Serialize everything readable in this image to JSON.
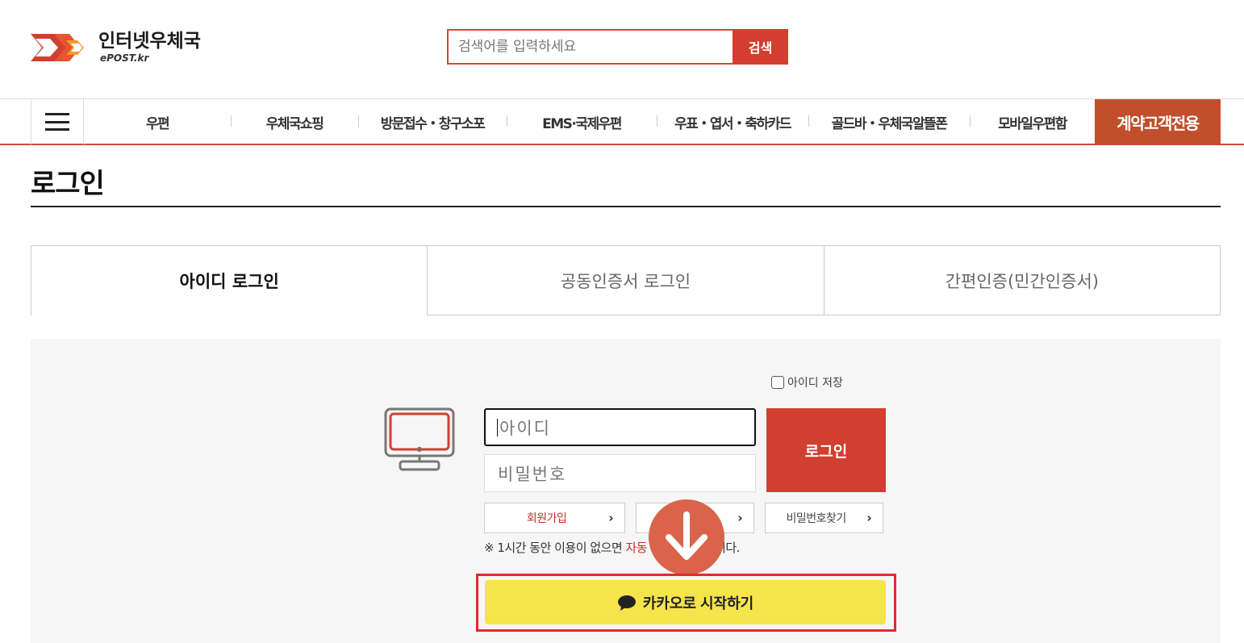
{
  "header": {
    "logo_title": "인터넷우체국",
    "logo_sub": "ePOST.kr",
    "search_placeholder": "검색어를 입력하세요",
    "search_button": "검색"
  },
  "nav": {
    "items": [
      "우편",
      "우체국쇼핑",
      "방문접수・창구소포",
      "EMS·국제우편",
      "우표・엽서・축하카드",
      "골드바・우체국알뜰폰",
      "모바일우편함"
    ],
    "contract": "계약고객전용"
  },
  "page": {
    "title": "로그인"
  },
  "tabs": [
    {
      "label": "아이디 로그인",
      "active": true
    },
    {
      "label": "공동인증서 로그인",
      "active": false
    },
    {
      "label": "간편인증(민간인증서)",
      "active": false
    }
  ],
  "login": {
    "save_id_label": "아이디 저장",
    "id_placeholder": "아이디",
    "pw_placeholder": "비밀번호",
    "login_button": "로그인",
    "signup": "회원가입",
    "find_id": "",
    "find_pw": "비밀번호찾기",
    "notice_prefix": "※ 1시간 동안 이용이 없으면 ",
    "notice_highlight": "자동",
    "notice_suffix": "니다.",
    "kakao_button": "카카오로 시작하기"
  },
  "colors": {
    "brand_red": "#d13f30",
    "contract_orange": "#c14f2c",
    "kakao_yellow": "#f5e44c",
    "highlight_frame": "#e02a30"
  }
}
